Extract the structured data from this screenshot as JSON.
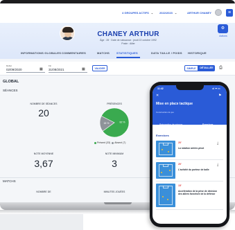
{
  "topbar": {
    "selector1": "4 GROUPES ACTIFS",
    "selector2": "2022/2023",
    "user": "ARTHUR CHANEY",
    "chevron": "⌄"
  },
  "header": {
    "name": "CHANEY ARTHUR",
    "subline": "Âge : 28 · Date de naissance : jeudi 22 octobre 1992",
    "poste": "Poste : Ailier",
    "actions_label": "Actions"
  },
  "tabs": [
    {
      "label": "INFORMATIONS GLOBALES"
    },
    {
      "label": "COMMENTAIRES"
    },
    {
      "label": "MATCHS"
    },
    {
      "label": "STATISTIQUES"
    },
    {
      "label": "DATA TAILLE / POIDS"
    },
    {
      "label": "HISTORIQUE"
    }
  ],
  "filters": {
    "debut_label": "Début",
    "debut_value": "02/09/2020",
    "fin_label": "Fin",
    "fin_value": "31/08/2021",
    "validate": "VALIDER",
    "simple": "SIMPLE",
    "detail": "DÉTAILLÉE"
  },
  "stats": {
    "global_title": "GLOBAL",
    "seances_title": "SÉANCES",
    "nb_seances_label": "NOMBRE DE SÉANCES",
    "nb_seances_value": "20",
    "presences_label": "PRÉSENCES",
    "legend_present": "Présent (33)",
    "legend_absent": "Absent (7)",
    "note_moyenne_label": "NOTE MOYENNE",
    "note_moyenne_value": "3,67",
    "note_min_label": "NOTE MINIMUM",
    "note_min_value": "3",
    "matchs_title": "MATCHS",
    "nb_label": "NOMBRE DE",
    "minutes_label": "MINUTES JOUÉES"
  },
  "chart_data": {
    "type": "pie",
    "title": "PRÉSENCES",
    "categories": [
      "Présent",
      "Absent"
    ],
    "values": [
      33,
      7
    ],
    "slice_labels": [
      "82 %",
      "18 %"
    ],
    "colors": [
      "#3aaa4f",
      "#8e9399"
    ],
    "legend_position": "bottom"
  },
  "phone": {
    "time": "11:42",
    "signal": "•ıl ᯤ ▭",
    "close": "✕",
    "flag": "⚑",
    "title": "Mise en place tactique",
    "subtitle": "Construction du jeu",
    "tab1": "Préparation de séance",
    "tab2": "Exercices",
    "section": "Exercices",
    "cards": [
      {
        "duration": "20'",
        "title": "La rotation arrière-pivot"
      },
      {
        "duration": "20'",
        "title": "L'activité du porteur de balle"
      },
      {
        "duration": "15'",
        "title": "Accélération de la prise de décision des ailiers favorisée de la défense"
      }
    ],
    "download": "⤓"
  },
  "colors": {
    "accent": "#2a5bd7",
    "present": "#3aaa4f",
    "absent": "#8e9399",
    "duration": "#e23a3a"
  },
  "icons": {
    "calendar": "calendar-icon",
    "print": "print-icon",
    "menu": "menu-icon",
    "actions": "actions-icon",
    "download": "download-icon",
    "close": "close-icon"
  }
}
